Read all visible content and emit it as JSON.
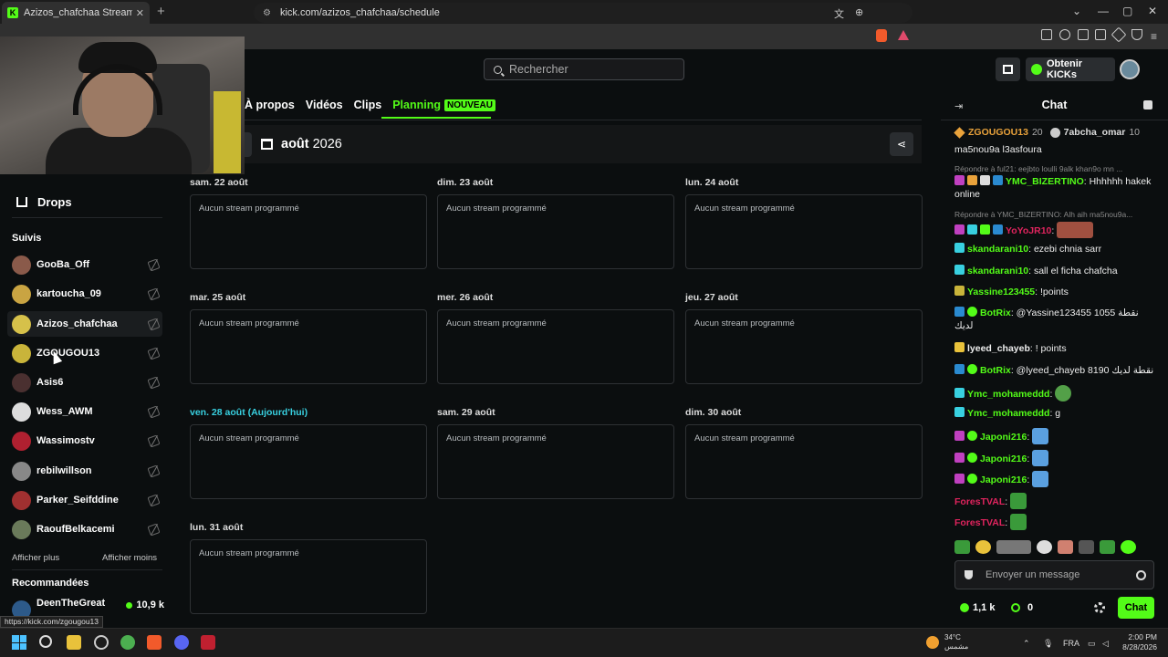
{
  "browser": {
    "tab_title": "Azizos_chafchaa Stream Schedule",
    "tab_close": "✕",
    "new_tab": "+",
    "url": "kick.com/azizos_chafchaa/schedule",
    "win_min": "—",
    "win_max": "▢",
    "win_close": "✕",
    "win_chevron": "⌄"
  },
  "header": {
    "search_placeholder": "Rechercher",
    "kicks_label": "Obtenir KICKs"
  },
  "sidebar": {
    "drops": "Drops",
    "followed_title": "Suivis",
    "followed": [
      {
        "name": "GooBa_Off",
        "color": "#8a5a4a"
      },
      {
        "name": "kartoucha_09",
        "color": "#c9a442"
      },
      {
        "name": "Azizos_chafchaa",
        "color": "#d6c14a"
      },
      {
        "name": "ZGOUGOU13",
        "color": "#c9b43a"
      },
      {
        "name": "Asis6",
        "color": "#4a3030"
      },
      {
        "name": "Wess_AWM",
        "color": "#ddd"
      },
      {
        "name": "Wassimostv",
        "color": "#b02030"
      },
      {
        "name": "rebilwillson",
        "color": "#888"
      },
      {
        "name": "Parker_Seifddine",
        "color": "#a03030"
      },
      {
        "name": "RaoufBelkacemi",
        "color": "#6a7a5a"
      }
    ],
    "show_more": "Afficher plus",
    "show_less": "Afficher moins",
    "recommended_title": "Recommandées",
    "recommended": {
      "name": "DeenTheGreat",
      "viewers": "10,9 k"
    },
    "status_url": "https://kick.com/zgougou13"
  },
  "tabs": {
    "about": "À propos",
    "videos": "Vidéos",
    "clips": "Clips",
    "planning": "Planning",
    "new_badge": "NOUVEAU"
  },
  "schedule": {
    "month": "août",
    "year": "2026",
    "days": [
      {
        "label": "sam. 22 août",
        "text": "Aucun stream programmé"
      },
      {
        "label": "dim. 23 août",
        "text": "Aucun stream programmé"
      },
      {
        "label": "lun. 24 août",
        "text": "Aucun stream programmé"
      },
      {
        "label": "mar. 25 août",
        "text": "Aucun stream programmé"
      },
      {
        "label": "mer. 26 août",
        "text": "Aucun stream programmé"
      },
      {
        "label": "jeu. 27 août",
        "text": "Aucun stream programmé"
      },
      {
        "label": "ven. 28 août (Aujourd'hui)",
        "text": "Aucun stream programmé"
      },
      {
        "label": "sam. 29 août",
        "text": "Aucun stream programmé"
      },
      {
        "label": "dim. 30 août",
        "text": "Aucun stream programmé"
      },
      {
        "label": "lun. 31 août",
        "text": "Aucun stream programmé"
      }
    ]
  },
  "chat": {
    "title": "Chat",
    "pinned_user1": "ZGOUGOU13",
    "pinned_count1": "20",
    "pinned_user2": "7abcha_omar",
    "pinned_count2": "10",
    "messages": [
      {
        "user": "",
        "text": "ma5nou9a l3asfoura",
        "color": "#eee"
      },
      {
        "reply": "Répondre à ful21: eejbto loulli 9alk khan9o mn ..."
      },
      {
        "user": "YMC_BIZERTINO",
        "text": ": Hhhhhh hakek online",
        "color": "#53fc18"
      },
      {
        "reply": "Répondre à YMC_BIZERTINO: Alh aih ma5nou9a..."
      },
      {
        "user": "YoYoJR10",
        "text": ":",
        "color": "#e0245e"
      },
      {
        "user": "skandarani10",
        "text": ": ezebi chnia sarr",
        "color": "#53fc18"
      },
      {
        "user": "skandarani10",
        "text": ": sall el ficha chafcha",
        "color": "#53fc18"
      },
      {
        "user": "Yassine123455",
        "text": ": !points",
        "color": "#53fc18"
      },
      {
        "user": "BotRix",
        "text": ": @Yassine123455 1055 نقطة لديك",
        "color": "#53fc18"
      },
      {
        "user": "lyeed_chayeb",
        "text": ": ! points",
        "color": "#eee"
      },
      {
        "user": "BotRix",
        "text": ": @lyeed_chayeb 8190 نقطة لديك",
        "color": "#53fc18"
      },
      {
        "user": "Ymc_mohameddd",
        "text": ":",
        "color": "#53fc18"
      },
      {
        "user": "Ymc_mohameddd",
        "text": ": g",
        "color": "#53fc18"
      },
      {
        "user": "Japoni216",
        "text": ":",
        "color": "#53fc18"
      },
      {
        "user": "Japoni216",
        "text": ":",
        "color": "#53fc18"
      },
      {
        "user": "Japoni216",
        "text": ":",
        "color": "#53fc18"
      },
      {
        "user": "ForesTVAL",
        "text": ":",
        "color": "#e0245e"
      },
      {
        "user": "ForesTVAL",
        "text": ":",
        "color": "#e0245e"
      }
    ],
    "input_placeholder": "Envoyer un message",
    "viewers": "1,1 k",
    "kicks": "0",
    "send": "Chat"
  },
  "taskbar": {
    "temp": "34°C",
    "weather": "مشمس",
    "lang": "FRA",
    "time": "2:00 PM",
    "date": "8/28/2026"
  },
  "colors": {
    "accent": "#53fc18",
    "today": "#38d0e0"
  }
}
